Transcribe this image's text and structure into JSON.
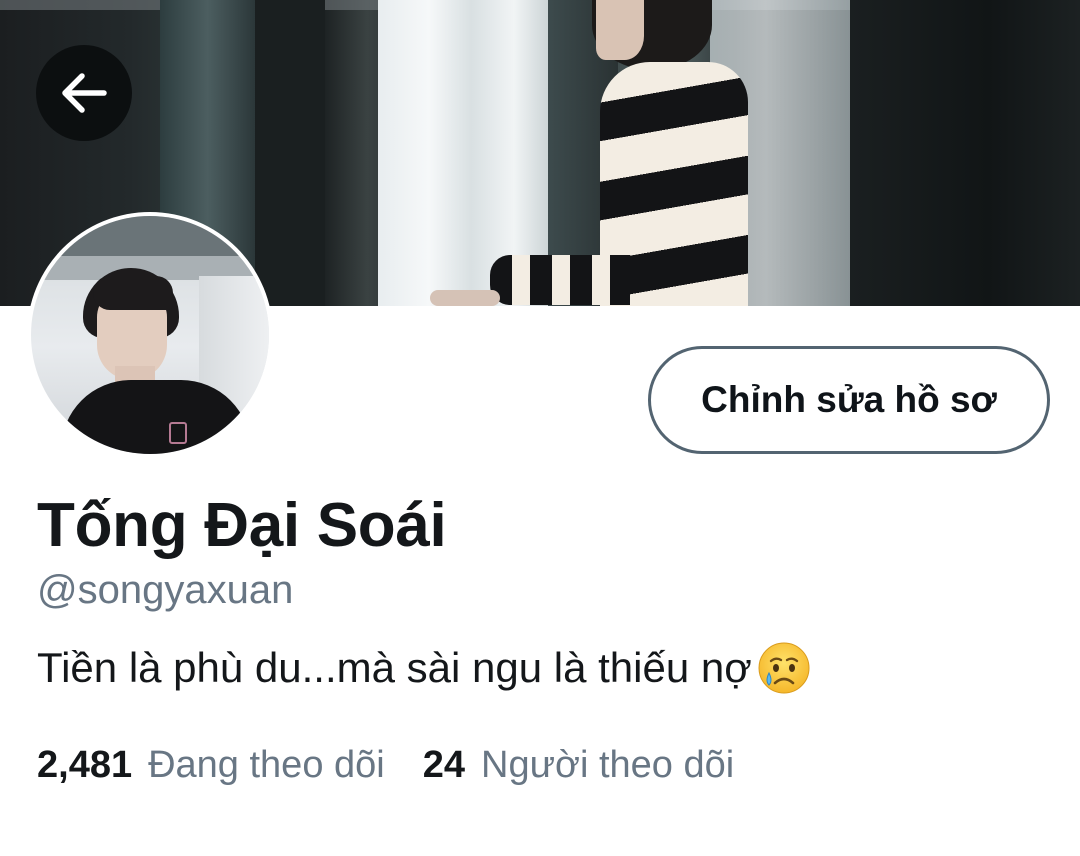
{
  "profile": {
    "display_name": "Tống Đại Soái",
    "handle": "@songyaxuan",
    "bio": "Tiền là phù du...mà sài ngu là thiếu nợ",
    "bio_emoji": "crying-face-emoji",
    "edit_button_label": "Chỉnh sửa hồ sơ"
  },
  "stats": {
    "following_count": "2,481",
    "following_label": "Đang theo dõi",
    "followers_count": "24",
    "followers_label": "Người theo dõi"
  },
  "icons": {
    "back": "arrow-left-icon"
  },
  "colors": {
    "text_primary": "#14171a",
    "text_secondary": "#687684",
    "button_border": "#536471",
    "back_button_bg": "#0c0f10"
  }
}
